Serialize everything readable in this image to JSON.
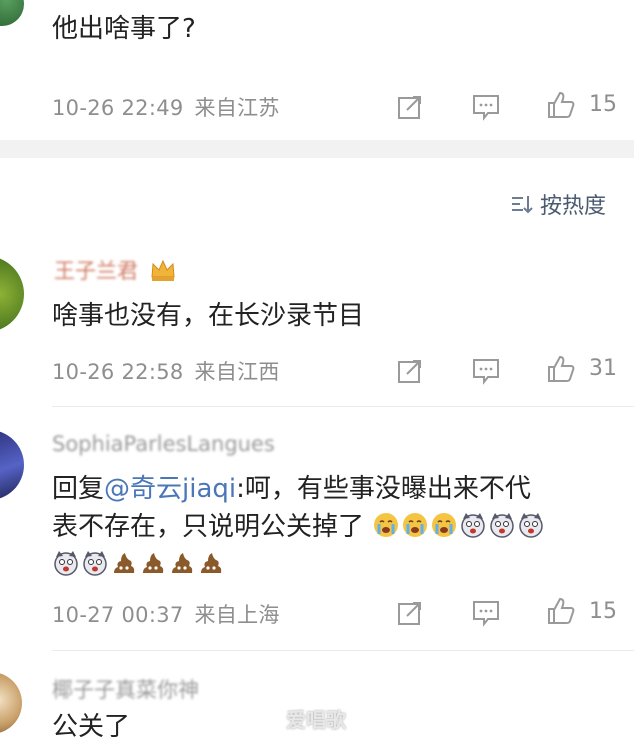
{
  "comments": [
    {
      "text": "他出啥事了?",
      "time": "10-26 22:49",
      "location": "来自江苏",
      "likes": "15"
    },
    {
      "username": "王子兰君",
      "text": "啥事也没有，在长沙录节目",
      "time": "10-26 22:58",
      "location": "来自江西",
      "likes": "31"
    },
    {
      "username": "SophiaParlesLangues",
      "reply_prefix": "回复",
      "reply_mention": "@奇云jiaqi",
      "text_line1": ":呵，有些事没曝出来不代",
      "text_line2": "表不存在，只说明公关掉了",
      "time": "10-27 00:37",
      "location": "来自上海",
      "likes": "15"
    },
    {
      "username": "椰子子真菜你神",
      "text": "公关了"
    }
  ],
  "sort": {
    "label": "按热度"
  },
  "watermark": "爱唱歌",
  "icons": {
    "share": "share-icon",
    "comment": "comment-icon",
    "like": "thumbs-up-icon",
    "sort": "sort-icon",
    "crown": "crown-badge-icon"
  }
}
